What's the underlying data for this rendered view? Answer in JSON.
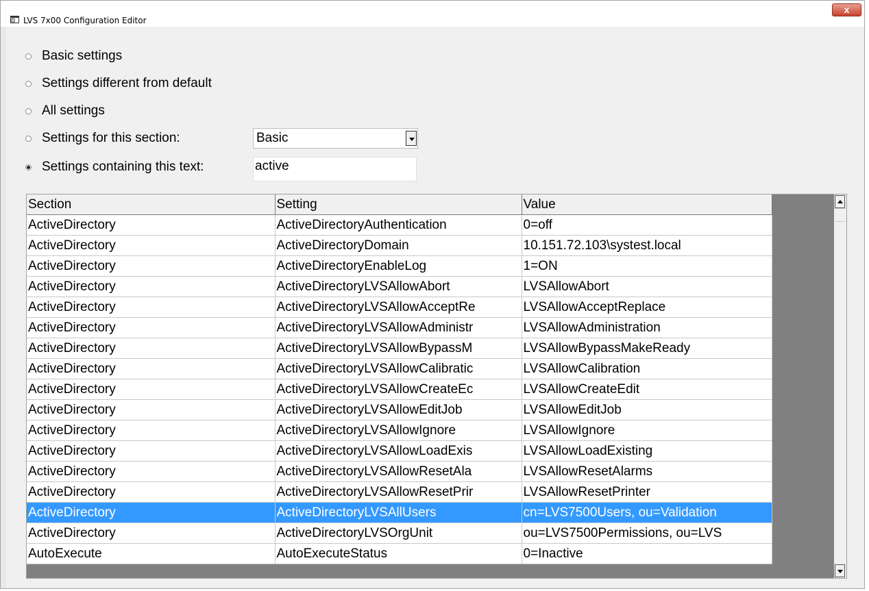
{
  "window": {
    "title": "LVS 7x00 Configuration Editor",
    "close_label": "x"
  },
  "filters": {
    "basic": "Basic settings",
    "different": "Settings different from default",
    "all": "All settings",
    "section": "Settings for this section:",
    "containing": "Settings containing this text:",
    "selected": "containing"
  },
  "section_select": {
    "value": "Basic"
  },
  "search_text": {
    "value": "active"
  },
  "grid": {
    "headers": [
      "Section",
      "Setting",
      "Value"
    ],
    "selected_row": 14,
    "rows": [
      [
        "ActiveDirectory",
        "ActiveDirectoryAuthentication",
        "0=off"
      ],
      [
        "ActiveDirectory",
        "ActiveDirectoryDomain",
        "10.151.72.103\\systest.local"
      ],
      [
        "ActiveDirectory",
        "ActiveDirectoryEnableLog",
        "1=ON"
      ],
      [
        "ActiveDirectory",
        "ActiveDirectoryLVSAllowAbort",
        "LVSAllowAbort"
      ],
      [
        "ActiveDirectory",
        "ActiveDirectoryLVSAllowAcceptRe",
        "LVSAllowAcceptReplace"
      ],
      [
        "ActiveDirectory",
        "ActiveDirectoryLVSAllowAdministr",
        "LVSAllowAdministration"
      ],
      [
        "ActiveDirectory",
        "ActiveDirectoryLVSAllowBypassM",
        "LVSAllowBypassMakeReady"
      ],
      [
        "ActiveDirectory",
        "ActiveDirectoryLVSAllowCalibratic",
        "LVSAllowCalibration"
      ],
      [
        "ActiveDirectory",
        "ActiveDirectoryLVSAllowCreateEc",
        "LVSAllowCreateEdit"
      ],
      [
        "ActiveDirectory",
        "ActiveDirectoryLVSAllowEditJob",
        "LVSAllowEditJob"
      ],
      [
        "ActiveDirectory",
        "ActiveDirectoryLVSAllowIgnore",
        "LVSAllowIgnore"
      ],
      [
        "ActiveDirectory",
        "ActiveDirectoryLVSAllowLoadExis",
        "LVSAllowLoadExisting"
      ],
      [
        "ActiveDirectory",
        "ActiveDirectoryLVSAllowResetAla",
        "LVSAllowResetAlarms"
      ],
      [
        "ActiveDirectory",
        "ActiveDirectoryLVSAllowResetPrir",
        "LVSAllowResetPrinter"
      ],
      [
        "ActiveDirectory",
        "ActiveDirectoryLVSAllUsers",
        "cn=LVS7500Users, ou=Validation"
      ],
      [
        "ActiveDirectory",
        "ActiveDirectoryLVSOrgUnit",
        "ou=LVS7500Permissions, ou=LVS"
      ],
      [
        "AutoExecute",
        "AutoExecuteStatus",
        "0=Inactive"
      ]
    ]
  },
  "colors": {
    "selection": "#3399ff",
    "grid_background": "#808080",
    "close_button": "#c7432c"
  }
}
